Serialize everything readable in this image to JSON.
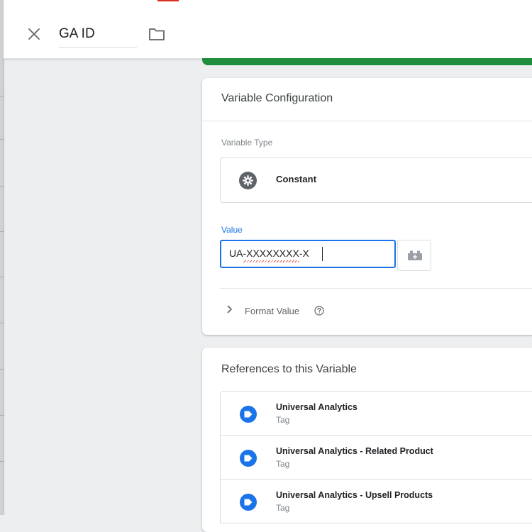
{
  "header": {
    "variable_name": "GA ID"
  },
  "config_card": {
    "title": "Variable Configuration",
    "variable_type_label": "Variable Type",
    "variable_type_value": "Constant",
    "value_label": "Value",
    "value": "UA-XXXXXXXX-X",
    "format_value_label": "Format Value"
  },
  "references_card": {
    "title": "References to this Variable",
    "items": [
      {
        "name": "Universal Analytics",
        "type": "Tag"
      },
      {
        "name": "Universal Analytics - Related Product",
        "type": "Tag"
      },
      {
        "name": "Universal Analytics - Upsell Products",
        "type": "Tag"
      }
    ]
  },
  "colors": {
    "accent": "#1a73e8",
    "success": "#1e8e3e",
    "tag_icon": "#1a73e8",
    "top_indicator": "#d93025"
  },
  "icons": [
    "close-icon",
    "folder-icon",
    "gear-icon",
    "variable-picker-icon",
    "chevron-right-icon",
    "help-icon",
    "tag-icon"
  ]
}
